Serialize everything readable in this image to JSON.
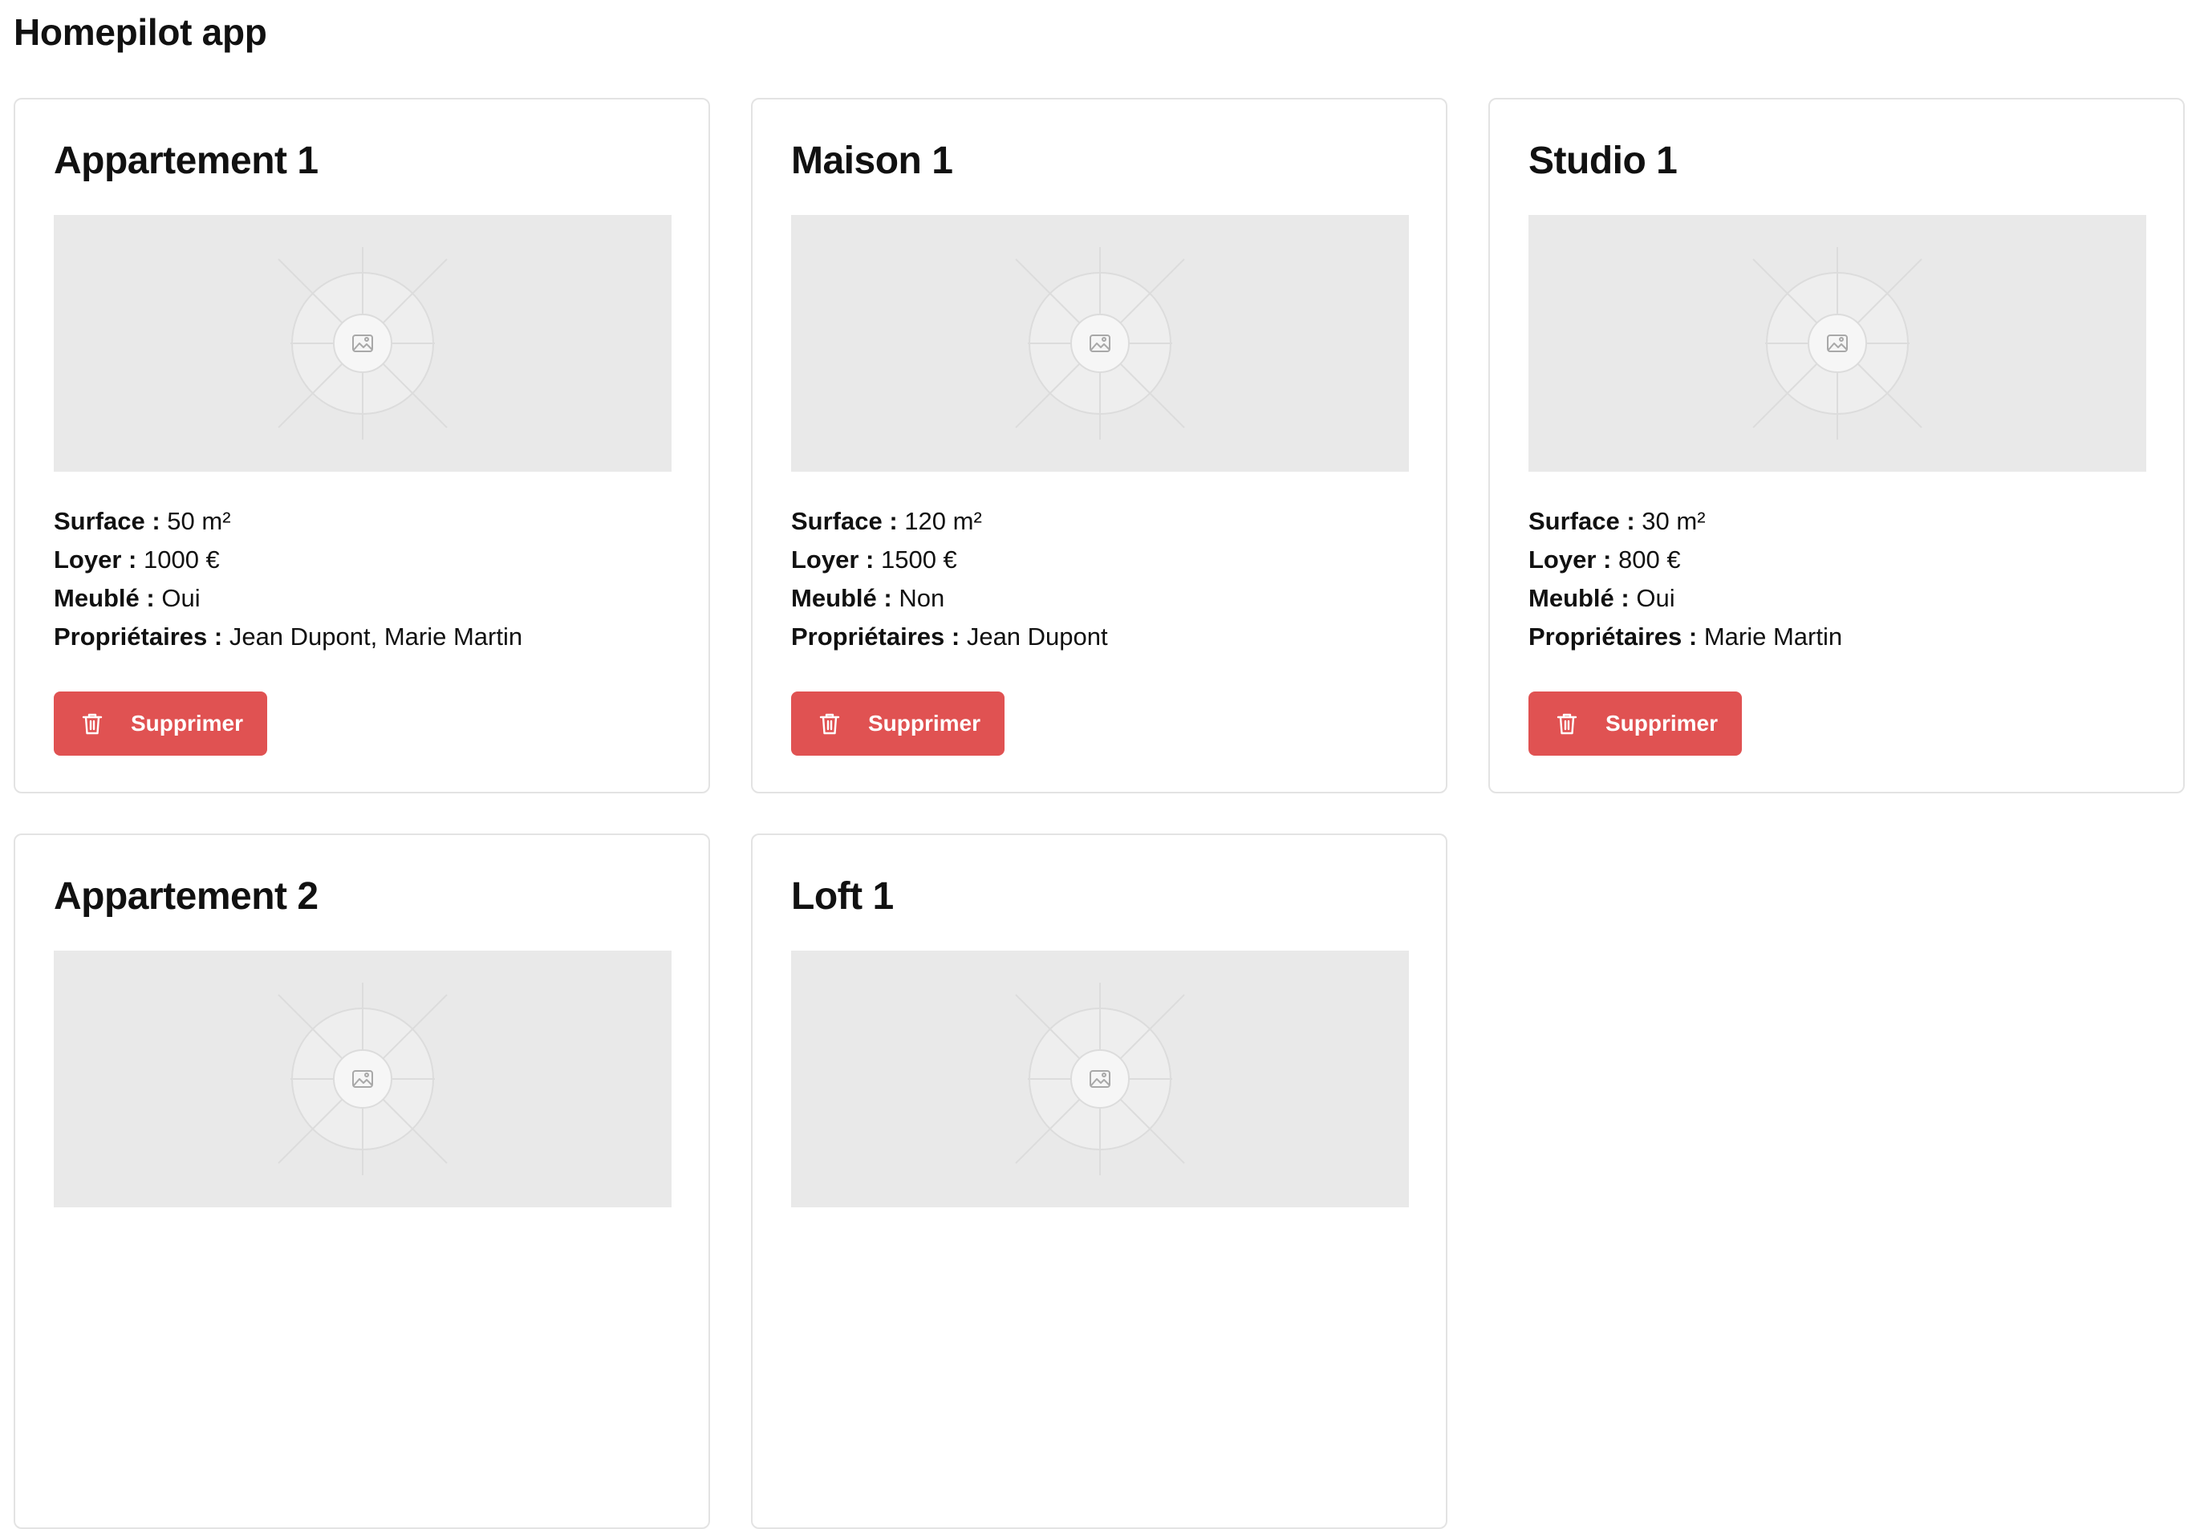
{
  "app": {
    "title": "Homepilot app"
  },
  "labels": {
    "surface": "Surface :",
    "loyer": "Loyer :",
    "meuble": "Meublé :",
    "proprietaires": "Propriétaires :"
  },
  "colors": {
    "accent": "#e05252",
    "placeholder": "#e9e9e9",
    "card_border": "#e3e3e3"
  },
  "properties": [
    {
      "name": "Appartement 1",
      "image_icon": "image-placeholder-icon",
      "surface": "50 m²",
      "loyer": "1000 €",
      "meuble": "Oui",
      "proprietaires": "Jean Dupont, Marie Martin",
      "delete_label": "Supprimer",
      "delete_icon": "trash-icon"
    },
    {
      "name": "Maison 1",
      "image_icon": "image-placeholder-icon",
      "surface": "120 m²",
      "loyer": "1500 €",
      "meuble": "Non",
      "proprietaires": "Jean Dupont",
      "delete_label": "Supprimer",
      "delete_icon": "trash-icon"
    },
    {
      "name": "Studio 1",
      "image_icon": "image-placeholder-icon",
      "surface": "30 m²",
      "loyer": "800 €",
      "meuble": "Oui",
      "proprietaires": "Marie Martin",
      "delete_label": "Supprimer",
      "delete_icon": "trash-icon"
    },
    {
      "name": "Appartement 2",
      "image_icon": "image-placeholder-icon",
      "surface": "",
      "loyer": "",
      "meuble": "",
      "proprietaires": "",
      "delete_label": "",
      "delete_icon": "trash-icon"
    },
    {
      "name": "Loft 1",
      "image_icon": "image-placeholder-icon",
      "surface": "",
      "loyer": "",
      "meuble": "",
      "proprietaires": "",
      "delete_label": "",
      "delete_icon": "trash-icon"
    }
  ]
}
